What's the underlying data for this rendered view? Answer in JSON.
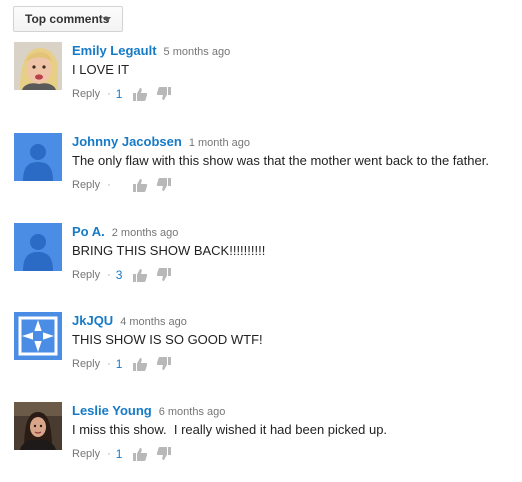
{
  "sort": {
    "label": "Top comments"
  },
  "comments": [
    {
      "author": "Emily Legault",
      "time": "5 months ago",
      "text": "I LOVE IT",
      "reply": "Reply",
      "dot": "·",
      "likes": "1",
      "avatar": "photo-blonde-woman"
    },
    {
      "author": "Johnny Jacobsen",
      "time": "1 month ago",
      "text": "The only flaw with this show was that the mother went back to the father.",
      "reply": "Reply",
      "dot": "·",
      "likes": "",
      "avatar": "default-user-icon"
    },
    {
      "author": "Po A.",
      "time": "2 months ago",
      "text": "BRING THIS SHOW BACK!!!!!!!!!!",
      "reply": "Reply",
      "dot": "·",
      "likes": "3",
      "avatar": "default-user-icon"
    },
    {
      "author": "JkJQU",
      "time": "4 months ago",
      "text": "THIS SHOW IS SO GOOD WTF!",
      "reply": "Reply",
      "dot": "·",
      "likes": "1",
      "avatar": "pattern-icon"
    },
    {
      "author": "Leslie Young",
      "time": "6 months ago",
      "text": "I miss this show.  I really wished it had been picked up.",
      "reply": "Reply",
      "dot": "·",
      "likes": "1",
      "avatar": "photo-dark-woman"
    }
  ],
  "colors": {
    "author": "#167ac6",
    "avatar_blue": "#4b8de5",
    "muted": "#767676"
  }
}
